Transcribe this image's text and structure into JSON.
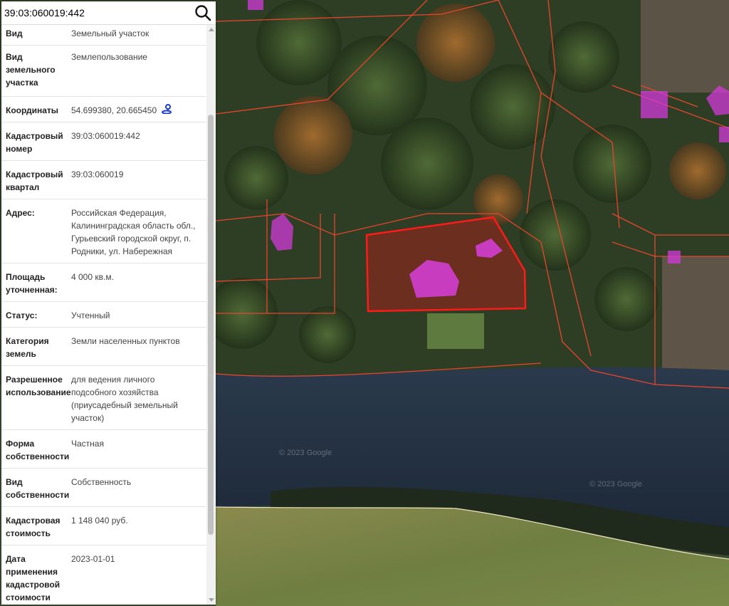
{
  "search": {
    "value": "39:03:060019:442"
  },
  "info": [
    {
      "label": "Вид",
      "value": "Земельный участок"
    },
    {
      "label": "Вид земельного участка",
      "value": "Землепользование"
    },
    {
      "label": "Координаты",
      "value": "54.699380, 20.665450"
    },
    {
      "label": "Кадастровый номер",
      "value": "39:03:060019:442"
    },
    {
      "label": "Кадастровый квартал",
      "value": "39:03:060019"
    },
    {
      "label": "Адрес:",
      "value": "Российская Федерация, Калининградская область обл., Гурьевский городской округ, п. Родники, ул. Набережная"
    },
    {
      "label": "Площадь уточненная:",
      "value": "4 000 кв.м."
    },
    {
      "label": "Статус:",
      "value": "Учтенный"
    },
    {
      "label": "Категория земель",
      "value": "Земли населенных пунктов"
    },
    {
      "label": "Разрешенное использование",
      "value": "для ведения личного подсобного хозяйства (приусадебный земельный участок)"
    },
    {
      "label": "Форма собственности",
      "value": "Частная"
    },
    {
      "label": "Вид собственности",
      "value": "Собственность"
    },
    {
      "label": "Кадастровая стоимость",
      "value": "1 148 040 руб."
    },
    {
      "label": "Дата применения кадастровой стоимости",
      "value": "2023-01-01"
    }
  ],
  "map": {
    "watermark_1": "© 2023 Google",
    "watermark_2": "© 2023 Google",
    "parcel_color": "#ff1a1a",
    "boundary_color": "#e8452e",
    "building_color": "#d23ad8"
  },
  "icons": {
    "search": "search-icon",
    "coordinates": "map-pin-icon"
  }
}
